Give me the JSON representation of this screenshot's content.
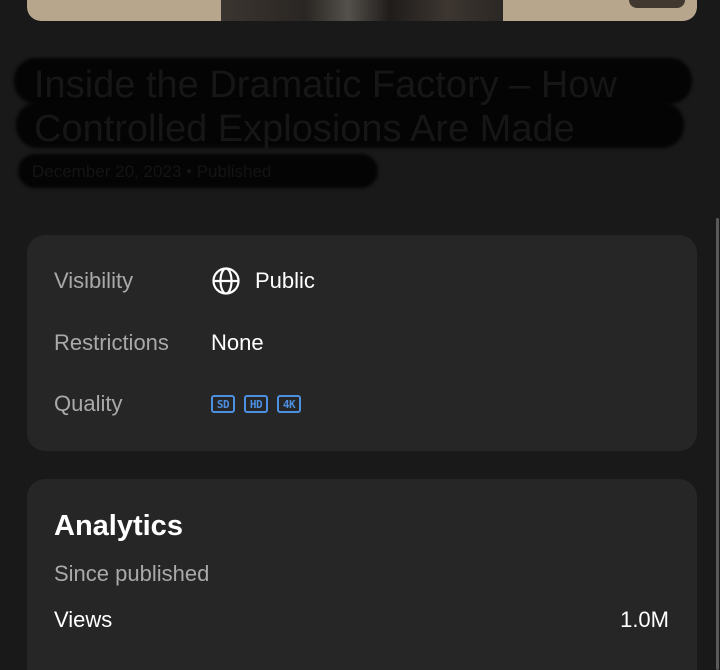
{
  "colors": {
    "background": "#191919",
    "card": "#262626",
    "label": "#a9a9a9",
    "value": "#ffffff",
    "badge_accent": "#4d8fe0"
  },
  "video": {
    "title_line_1": "Inside the Dramatic Factory – How",
    "title_line_2": "Controlled Explosions Are Made",
    "meta": "December 20, 2023 • Published"
  },
  "details": {
    "visibility_label": "Visibility",
    "visibility_value": "Public",
    "visibility_icon": "globe-icon",
    "restrictions_label": "Restrictions",
    "restrictions_value": "None",
    "quality_label": "Quality",
    "quality_badges": [
      "SD",
      "HD",
      "4K"
    ]
  },
  "analytics": {
    "title": "Analytics",
    "subtitle": "Since published",
    "views_label": "Views",
    "views_value": "1.0M"
  }
}
